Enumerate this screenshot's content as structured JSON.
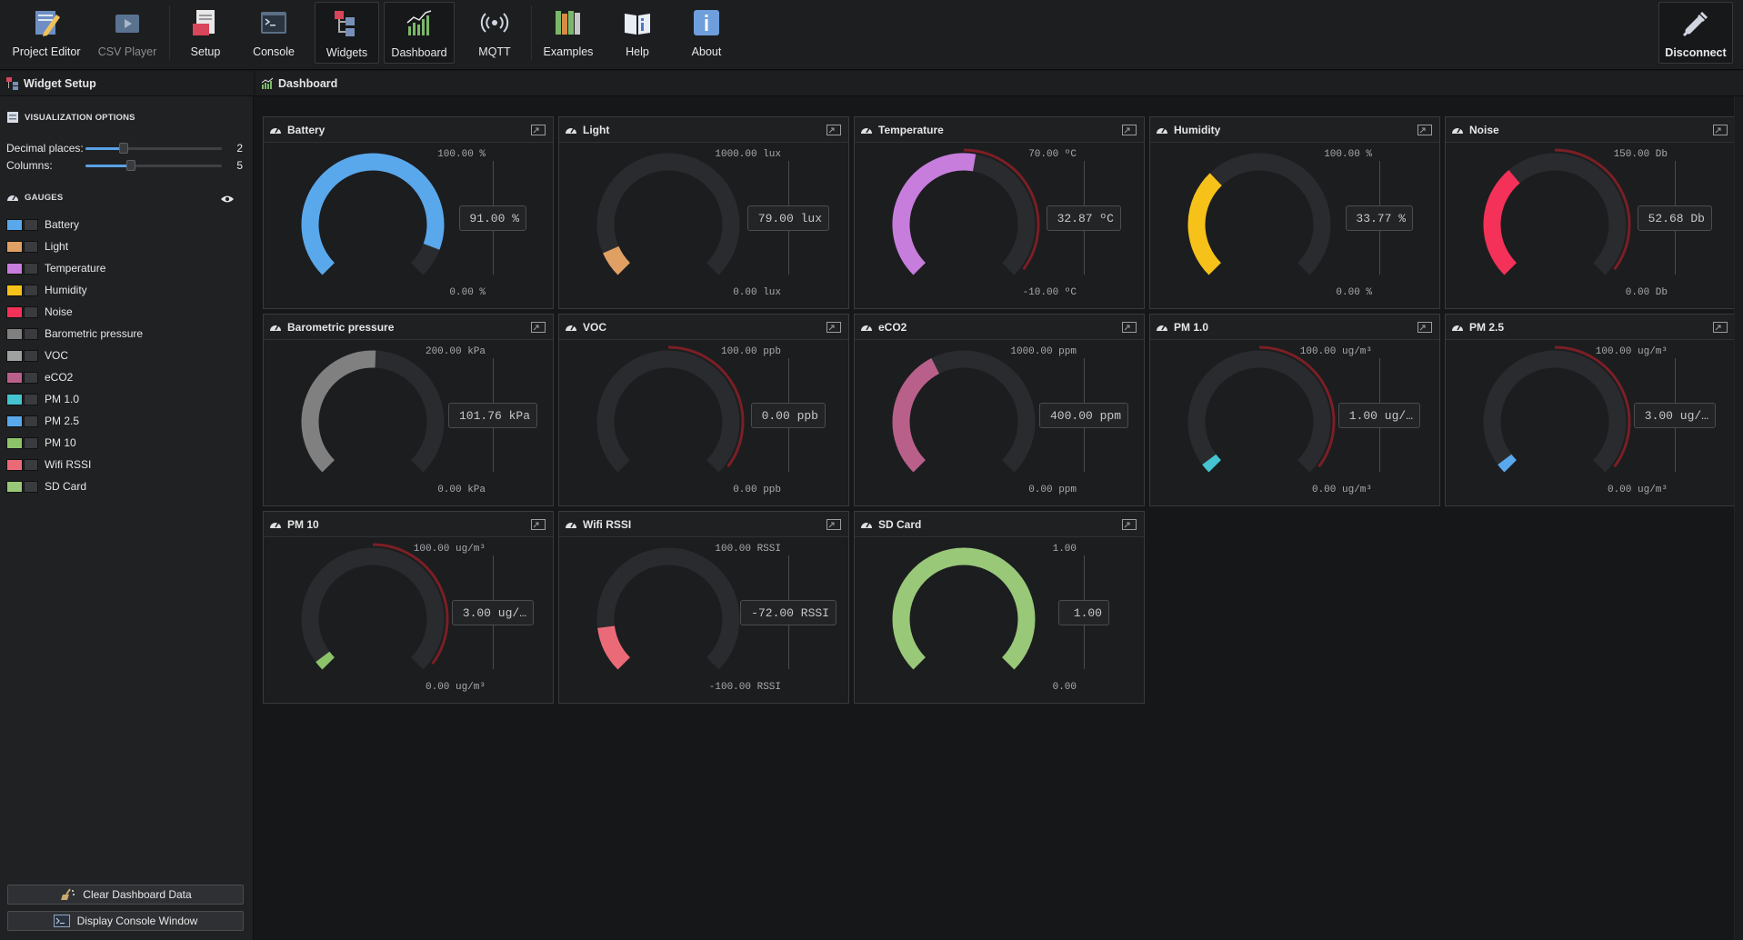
{
  "toolbar": {
    "buttons": [
      {
        "label": "Project Editor"
      },
      {
        "label": "CSV Player"
      },
      {
        "label": "Setup"
      },
      {
        "label": "Console"
      },
      {
        "label": "Widgets"
      },
      {
        "label": "Dashboard"
      },
      {
        "label": "MQTT"
      },
      {
        "label": "Examples"
      },
      {
        "label": "Help"
      },
      {
        "label": "About"
      }
    ],
    "disconnect_label": "Disconnect"
  },
  "left": {
    "header": "Widget Setup",
    "vis_title": "VISUALIZATION OPTIONS",
    "decimal_label": "Decimal places:",
    "decimal_value": "2",
    "decimal_fraction": 0.28,
    "columns_label": "Columns:",
    "columns_value": "5",
    "columns_fraction": 0.33,
    "gauges_title": "GAUGES",
    "gauges": [
      {
        "label": "Battery",
        "color": "#5aa8ec"
      },
      {
        "label": "Light",
        "color": "#e0a064"
      },
      {
        "label": "Temperature",
        "color": "#c77ddc"
      },
      {
        "label": "Humidity",
        "color": "#f6c21a"
      },
      {
        "label": "Noise",
        "color": "#f43158"
      },
      {
        "label": "Barometric pressure",
        "color": "#808080"
      },
      {
        "label": "VOC",
        "color": "#a0a0a0"
      },
      {
        "label": "eCO2",
        "color": "#b9608a"
      },
      {
        "label": "PM 1.0",
        "color": "#45c3d0"
      },
      {
        "label": "PM 2.5",
        "color": "#5aa8ec"
      },
      {
        "label": "PM 10",
        "color": "#8cc36a"
      },
      {
        "label": "Wifi RSSI",
        "color": "#ea6a78"
      },
      {
        "label": "SD Card",
        "color": "#98c878"
      }
    ],
    "clear_label": "Clear Dashboard Data",
    "console_label": "Display Console Window"
  },
  "dashboard": {
    "header": "Dashboard",
    "widgets": [
      {
        "title": "Battery",
        "max_label": "100.00 %",
        "min_label": "0.00 %",
        "value_label": "91.00 %",
        "min": 0,
        "max": 100,
        "value": 91,
        "color": "#5aa8ec",
        "alarm": false
      },
      {
        "title": "Light",
        "max_label": "1000.00 lux",
        "min_label": "0.00 lux",
        "value_label": "79.00 lux",
        "min": 0,
        "max": 1000,
        "value": 79,
        "color": "#e0a064",
        "alarm": false
      },
      {
        "title": "Temperature",
        "max_label": "70.00 ºC",
        "min_label": "-10.00 ºC",
        "value_label": "32.87 ºC",
        "min": -10,
        "max": 70,
        "value": 32.87,
        "color": "#c77ddc",
        "alarm": true
      },
      {
        "title": "Humidity",
        "max_label": "100.00 %",
        "min_label": "0.00 %",
        "value_label": "33.77 %",
        "min": 0,
        "max": 100,
        "value": 33.77,
        "color": "#f6c21a",
        "alarm": false
      },
      {
        "title": "Noise",
        "max_label": "150.00 Db",
        "min_label": "0.00 Db",
        "value_label": "52.68 Db",
        "min": 0,
        "max": 150,
        "value": 52.68,
        "color": "#f43158",
        "alarm": true
      },
      {
        "title": "Barometric pressure",
        "max_label": "200.00 kPa",
        "min_label": "0.00 kPa",
        "value_label": "101.76 kPa",
        "min": 0,
        "max": 200,
        "value": 101.76,
        "color": "#808080",
        "alarm": false
      },
      {
        "title": "VOC",
        "max_label": "100.00 ppb",
        "min_label": "0.00 ppb",
        "value_label": "0.00 ppb",
        "min": 0,
        "max": 100,
        "value": 0,
        "color": "#a0a0a0",
        "alarm": true
      },
      {
        "title": "eCO2",
        "max_label": "1000.00 ppm",
        "min_label": "0.00 ppm",
        "value_label": "400.00 ppm",
        "min": 0,
        "max": 1000,
        "value": 400,
        "color": "#b9608a",
        "alarm": false
      },
      {
        "title": "PM 1.0",
        "max_label": "100.00 ug/m³",
        "min_label": "0.00 ug/m³",
        "value_label": "1.00 ug/…",
        "min": 0,
        "max": 100,
        "value": 1,
        "color": "#45c3d0",
        "alarm": true
      },
      {
        "title": "PM 2.5",
        "max_label": "100.00 ug/m³",
        "min_label": "0.00 ug/m³",
        "value_label": "3.00 ug/…",
        "min": 0,
        "max": 100,
        "value": 3,
        "color": "#5aa8ec",
        "alarm": true
      },
      {
        "title": "PM 10",
        "max_label": "100.00 ug/m³",
        "min_label": "0.00 ug/m³",
        "value_label": "3.00 ug/…",
        "min": 0,
        "max": 100,
        "value": 3,
        "color": "#8cc36a",
        "alarm": true
      },
      {
        "title": "Wifi RSSI",
        "max_label": "100.00 RSSI",
        "min_label": "-100.00 RSSI",
        "value_label": "-72.00 RSSI",
        "min": -100,
        "max": 100,
        "value": -72,
        "color": "#ea6a78",
        "alarm": false
      },
      {
        "title": "SD Card",
        "max_label": "1.00",
        "min_label": "0.00",
        "value_label": "1.00",
        "min": 0,
        "max": 1,
        "value": 1,
        "color": "#98c878",
        "alarm": false
      }
    ]
  }
}
